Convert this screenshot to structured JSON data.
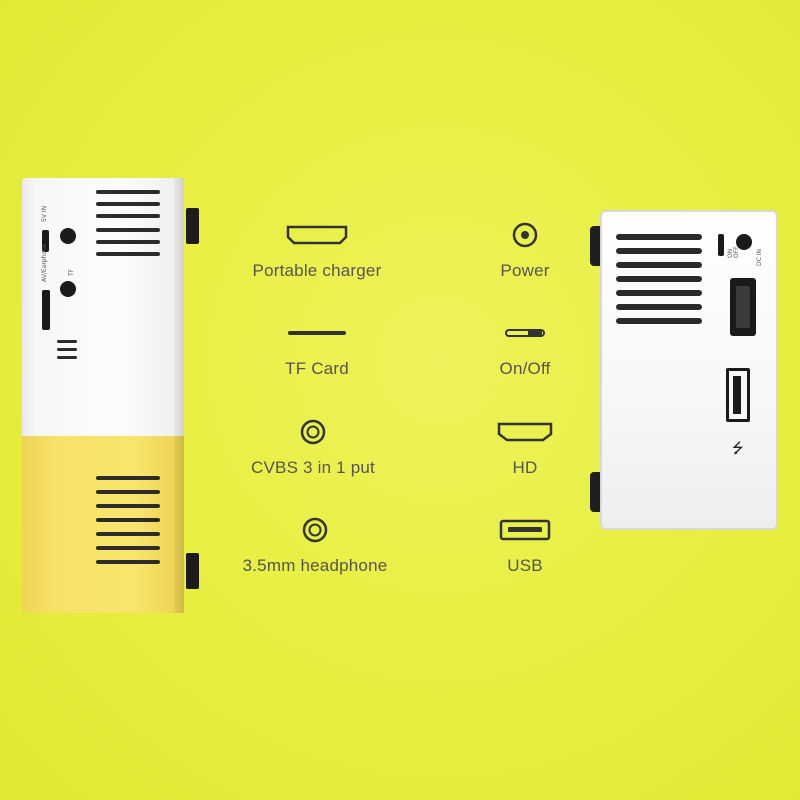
{
  "features": [
    {
      "label": "Portable charger",
      "icon": "micro-usb-port-icon"
    },
    {
      "label": "TF Card",
      "icon": "tf-card-slot-icon"
    },
    {
      "label": "CVBS 3 in 1 put",
      "icon": "round-jack-icon"
    },
    {
      "label": "3.5mm headphone",
      "icon": "round-jack-icon"
    },
    {
      "label": "Power",
      "icon": "dc-power-icon"
    },
    {
      "label": "On/Off",
      "icon": "switch-icon"
    },
    {
      "label": "HD",
      "icon": "hdmi-port-icon"
    },
    {
      "label": "USB",
      "icon": "usb-port-icon"
    }
  ],
  "colors": {
    "background": "#e6ef3e",
    "device_white": "#fdfdfd",
    "device_yellow": "#f8e168",
    "port_black": "#1a1a1a",
    "label": "#555550"
  },
  "device_left_port_labels": [
    "5V IN",
    "AV/Earphone",
    "TF"
  ],
  "device_right_port_labels": [
    "ON",
    "OFF",
    "DC IN"
  ]
}
